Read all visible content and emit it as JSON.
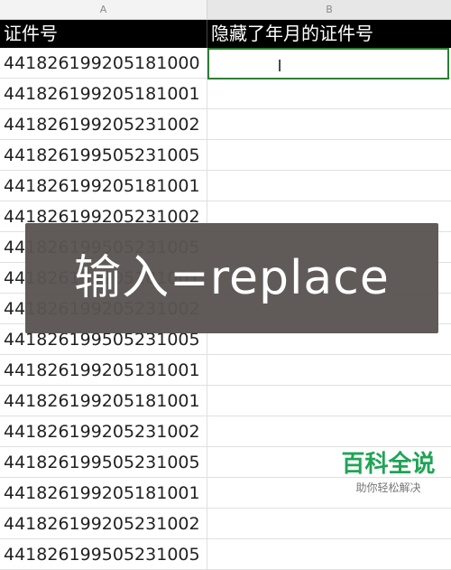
{
  "columns": {
    "a": "A",
    "b": "B"
  },
  "header": {
    "col_a": "证件号",
    "col_b": "隐藏了年月的证件号"
  },
  "rows": [
    "441826199205181000",
    "441826199205181001",
    "441826199205231002",
    "441826199505231005",
    "441826199205181001",
    "441826199205231002",
    "441826199505231005",
    "441826199205181001",
    "441826199205231002",
    "441826199505231005",
    "441826199205181001",
    "441826199205181001",
    "441826199205231002",
    "441826199505231005",
    "441826199205181001",
    "441826199205231002",
    "441826199505231005"
  ],
  "overlay": {
    "text": "输入=replace"
  },
  "watermark": {
    "title": "百科全说",
    "subtitle": "助你轻松解决"
  },
  "cursor_icon": "text-cursor-icon",
  "colors": {
    "selection": "#2f7d32",
    "watermark": "#20a455",
    "overlay": "#5a5452"
  }
}
